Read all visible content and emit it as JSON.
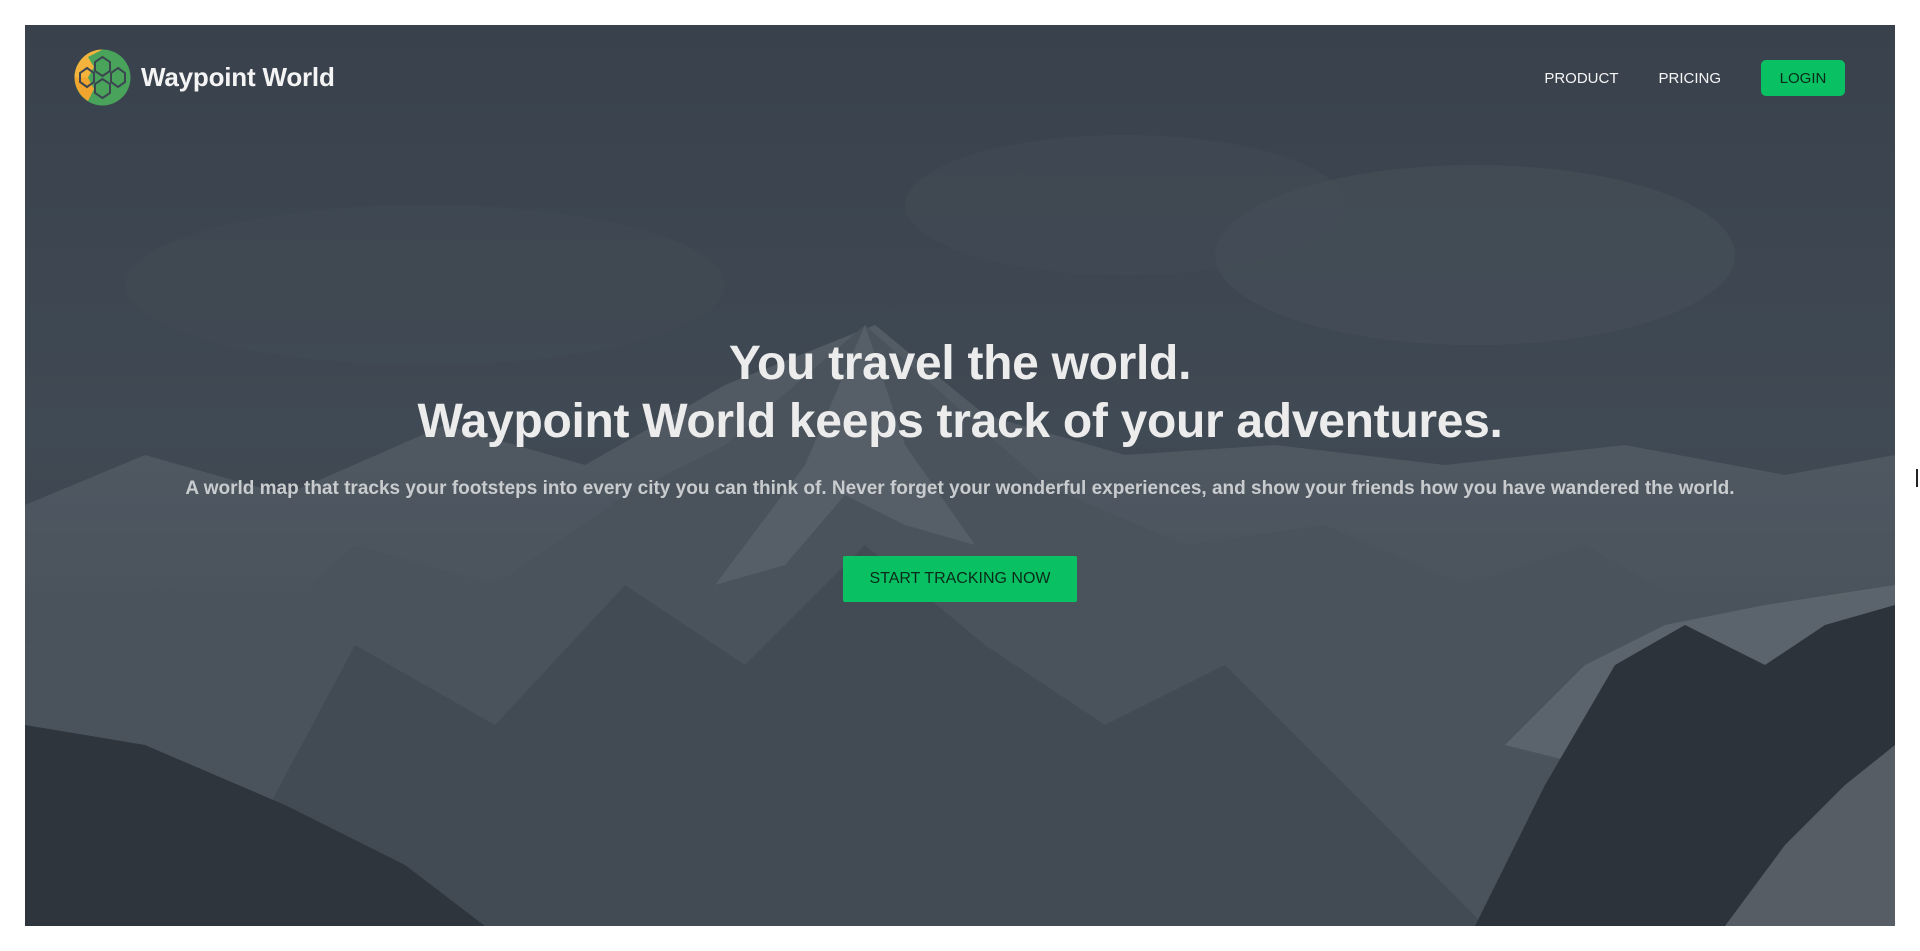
{
  "brand": {
    "name": "Waypoint World",
    "logo_icon": "globe-honeycomb-icon"
  },
  "nav": {
    "items": [
      {
        "label": "PRODUCT"
      },
      {
        "label": "PRICING"
      }
    ],
    "login_label": "LOGIN"
  },
  "hero": {
    "headline_line1": "You travel the world.",
    "headline_line2": "Waypoint World keeps track of your adventures.",
    "subtitle": "A world map that tracks your footsteps into every city you can think of. Never forget your wonderful experiences, and show your friends how you have wandered the world.",
    "cta_label": "START TRACKING NOW",
    "background": "mountain-landscape-image"
  },
  "colors": {
    "accent": "#09c163",
    "hero_overlay": "#3b4651",
    "text_light": "#ececec"
  }
}
